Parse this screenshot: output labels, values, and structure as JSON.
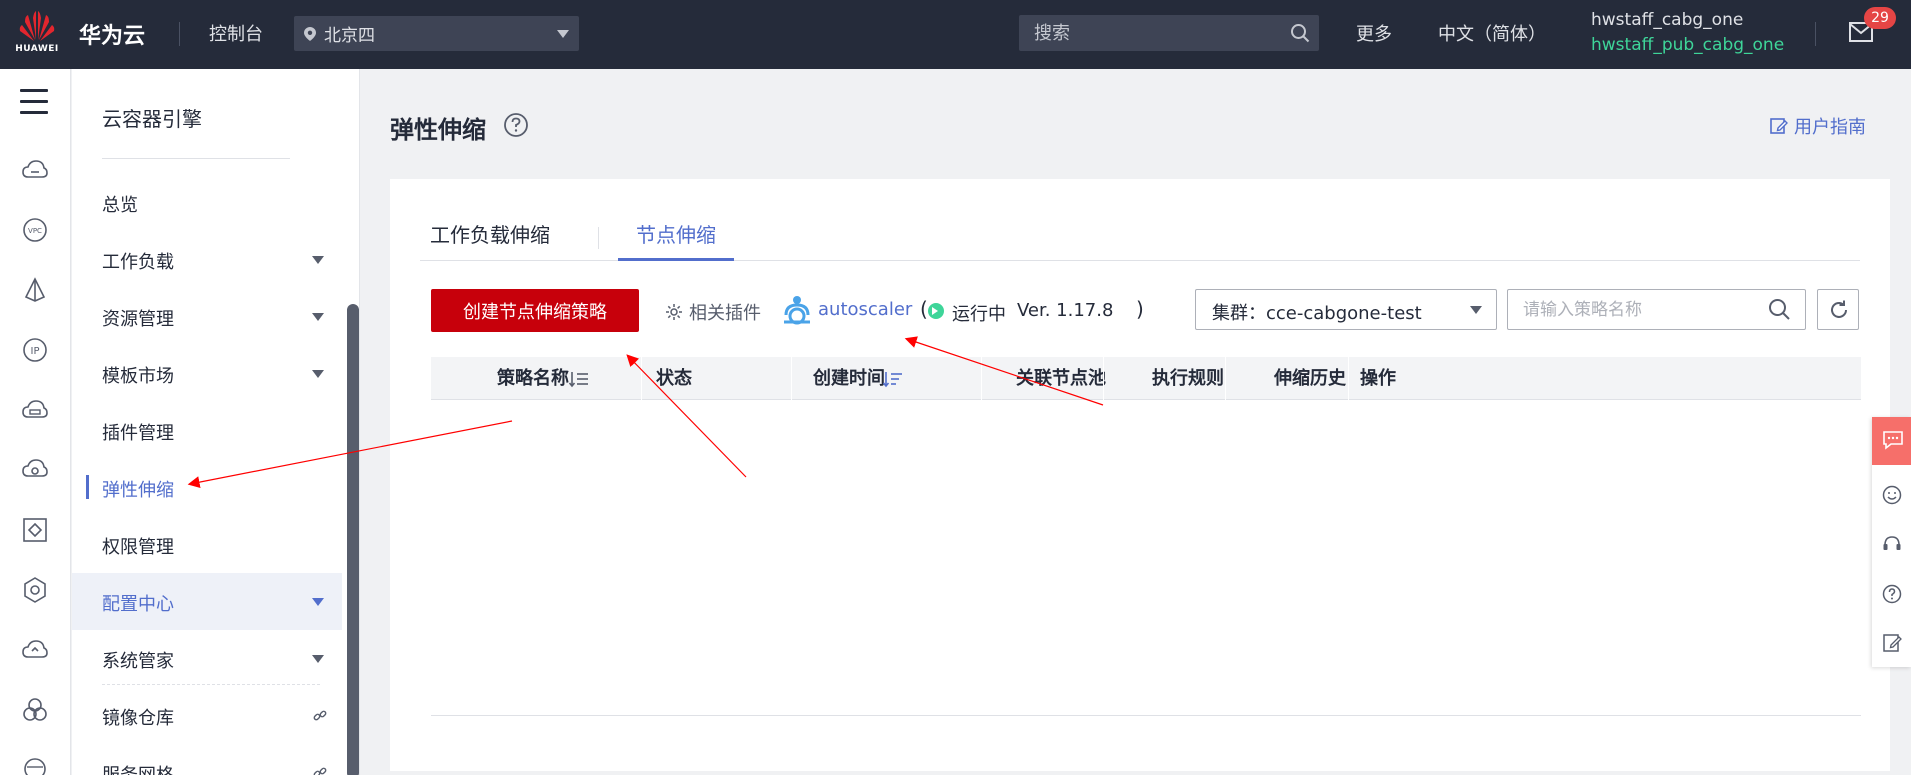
{
  "topbar": {
    "logo_text": "HUAWEI",
    "brand": "华为云",
    "console": "控制台",
    "region": "北京四",
    "search_placeholder": "搜索",
    "more": "更多",
    "language": "中文（简体）",
    "user_name": "hwstaff_cabg_one",
    "user_account": "hwstaff_pub_cabg_one",
    "message_count": "29"
  },
  "rail": {
    "icons": [
      "cloud-server-icon",
      "vpc-icon",
      "sail-icon",
      "ip-icon",
      "cloud-disk-icon",
      "cloud-gear-icon",
      "container-icon",
      "gear-box-icon",
      "cloud-upload-icon",
      "cluster-icon",
      "image-repo-icon"
    ]
  },
  "sidebar": {
    "title": "云容器引擎",
    "items": [
      {
        "label": "总览"
      },
      {
        "label": "工作负载"
      },
      {
        "label": "资源管理"
      },
      {
        "label": "模板市场"
      },
      {
        "label": "插件管理"
      },
      {
        "label": "弹性伸缩"
      },
      {
        "label": "权限管理"
      },
      {
        "label": "配置中心"
      },
      {
        "label": "系统管家"
      },
      {
        "label": "镜像仓库"
      },
      {
        "label": "服务网格"
      }
    ]
  },
  "main": {
    "page_title": "弹性伸缩",
    "user_guide": "用户指南",
    "tabs": [
      {
        "label": "工作负载伸缩"
      },
      {
        "label": "节点伸缩"
      }
    ],
    "create_button": "创建节点伸缩策略",
    "related_plugins": "相关插件",
    "plugin_name": "autoscaler",
    "paren_open": "(",
    "plugin_status": "运行中",
    "plugin_version": "Ver. 1.17.8",
    "paren_close": ")",
    "cluster_select": "集群：cce-cabgone-test",
    "policy_search_placeholder": "请输入策略名称",
    "table_headers": [
      "策略名称",
      "状态",
      "创建时间",
      "关联节点池",
      "执行规则",
      "伸缩历史",
      "操作"
    ]
  },
  "colors": {
    "topbar_bg": "#252b3a",
    "accent": "#526ecc",
    "primary_button": "#c7000b",
    "running_green": "#3ed599",
    "badge_red": "#e54545",
    "annotation_red": "#ff0000"
  }
}
